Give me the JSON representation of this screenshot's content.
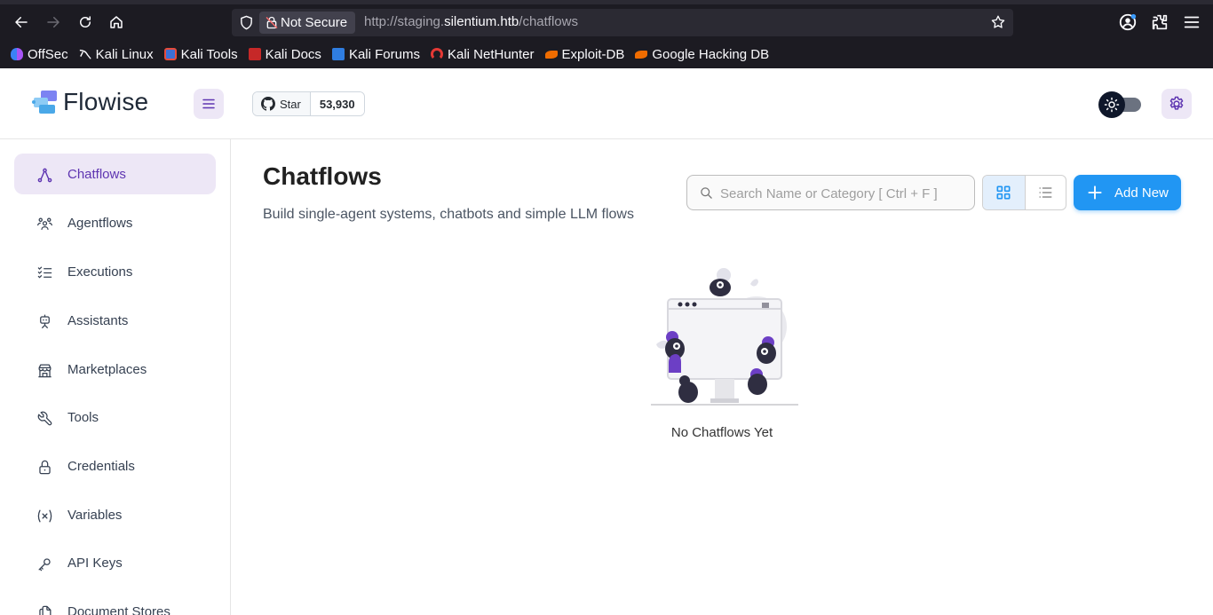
{
  "browser": {
    "security_label": "Not Secure",
    "url_prefix": "http://staging.",
    "url_domain": "silentium.htb",
    "url_path": "/chatflows",
    "bookmarks": [
      {
        "label": "OffSec"
      },
      {
        "label": "Kali Linux"
      },
      {
        "label": "Kali Tools"
      },
      {
        "label": "Kali Docs"
      },
      {
        "label": "Kali Forums"
      },
      {
        "label": "Kali NetHunter"
      },
      {
        "label": "Exploit-DB"
      },
      {
        "label": "Google Hacking DB"
      }
    ]
  },
  "header": {
    "logo_text": "Flowise",
    "github_star_label": "Star",
    "github_star_count": "53,930"
  },
  "sidebar": {
    "items": [
      {
        "label": "Chatflows",
        "icon": "hierarchy-icon",
        "active": true
      },
      {
        "label": "Agentflows",
        "icon": "users-group-icon"
      },
      {
        "label": "Executions",
        "icon": "list-check-icon"
      },
      {
        "label": "Assistants",
        "icon": "robot-icon"
      },
      {
        "label": "Marketplaces",
        "icon": "building-store-icon"
      },
      {
        "label": "Tools",
        "icon": "tool-icon"
      },
      {
        "label": "Credentials",
        "icon": "lock-icon"
      },
      {
        "label": "Variables",
        "icon": "variable-icon"
      },
      {
        "label": "API Keys",
        "icon": "key-icon"
      },
      {
        "label": "Document Stores",
        "icon": "files-icon"
      }
    ]
  },
  "main": {
    "title": "Chatflows",
    "subtitle": "Build single-agent systems, chatbots and simple LLM flows",
    "search_placeholder": "Search Name or Category [ Ctrl + F ]",
    "add_button_label": "Add New",
    "empty_message": "No Chatflows Yet"
  },
  "colors": {
    "accent": "#2196f3",
    "sidebar_active_bg": "#ede7f6",
    "sidebar_active_text": "#5e35b1",
    "browser_bg": "#1c1b22"
  }
}
